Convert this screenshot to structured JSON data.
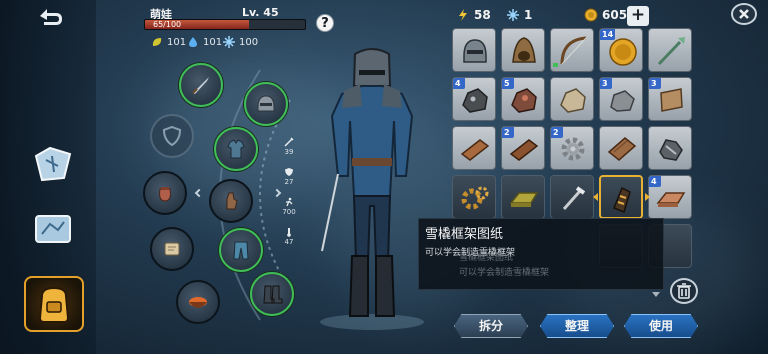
{
  "player": {
    "name": "萌娃",
    "level": "Lv. 45",
    "hp_text": "65/100",
    "hp_fraction": 0.65,
    "help_label": "?"
  },
  "resources": [
    {
      "icon": "leaf-icon",
      "value": "101"
    },
    {
      "icon": "water-drop-icon",
      "value": "101"
    },
    {
      "icon": "snowflake-icon",
      "value": "100"
    }
  ],
  "currency": {
    "energy": "58",
    "frost": "1",
    "coins": "605",
    "plus_label": "+"
  },
  "attributes": [
    {
      "icon": "attack-icon",
      "value": "39"
    },
    {
      "icon": "defense-icon",
      "value": "27"
    },
    {
      "icon": "speed-icon",
      "value": "700"
    },
    {
      "icon": "temperature-icon",
      "value": "47"
    }
  ],
  "inventory": [
    {
      "item": "helmet",
      "badge": ""
    },
    {
      "item": "hood",
      "badge": ""
    },
    {
      "item": "bow",
      "badge": ""
    },
    {
      "item": "gold-coin",
      "badge": "14"
    },
    {
      "item": "spear",
      "badge": ""
    },
    {
      "item": "iron-ore",
      "badge": "4"
    },
    {
      "item": "copper-ore",
      "badge": "5"
    },
    {
      "item": "silver-ore",
      "badge": ""
    },
    {
      "item": "stone",
      "badge": "3"
    },
    {
      "item": "leather-roll",
      "badge": "3"
    },
    {
      "item": "wood-plank",
      "badge": ""
    },
    {
      "item": "dark-plank",
      "badge": "2"
    },
    {
      "item": "gear",
      "badge": "2"
    },
    {
      "item": "wood-board",
      "badge": ""
    },
    {
      "item": "scrap-metal",
      "badge": ""
    },
    {
      "item": "golden-gear",
      "badge": ""
    },
    {
      "item": "gold-bar",
      "badge": ""
    },
    {
      "item": "nail",
      "badge": ""
    },
    {
      "item": "sled-frame-blueprint",
      "badge": ""
    },
    {
      "item": "copper-bar",
      "badge": "4"
    }
  ],
  "tooltip": {
    "title": "雪橇框架图纸",
    "description": "可以学会制造雪橇框架",
    "ghost_title": "雪橇框架图纸",
    "ghost_description": "可以学会制造雪橇框架"
  },
  "actions": {
    "split": "拆分",
    "sort": "整理",
    "use": "使用"
  },
  "colors": {
    "accent_gold": "#e9b134",
    "equipped_green": "#3fbf56",
    "badge_blue": "#3467c7",
    "hp_red": "#c4583d"
  }
}
